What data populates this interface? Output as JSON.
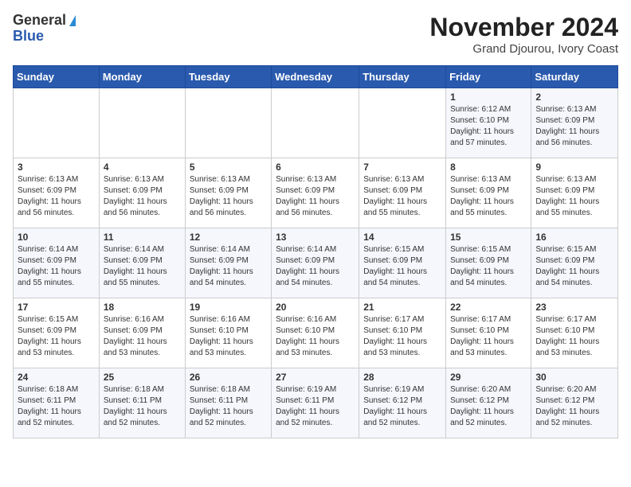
{
  "logo": {
    "general": "General",
    "blue": "Blue"
  },
  "header": {
    "month": "November 2024",
    "location": "Grand Djourou, Ivory Coast"
  },
  "weekdays": [
    "Sunday",
    "Monday",
    "Tuesday",
    "Wednesday",
    "Thursday",
    "Friday",
    "Saturday"
  ],
  "weeks": [
    [
      {
        "day": "",
        "sunrise": "",
        "sunset": "",
        "daylight": ""
      },
      {
        "day": "",
        "sunrise": "",
        "sunset": "",
        "daylight": ""
      },
      {
        "day": "",
        "sunrise": "",
        "sunset": "",
        "daylight": ""
      },
      {
        "day": "",
        "sunrise": "",
        "sunset": "",
        "daylight": ""
      },
      {
        "day": "",
        "sunrise": "",
        "sunset": "",
        "daylight": ""
      },
      {
        "day": "1",
        "sunrise": "Sunrise: 6:12 AM",
        "sunset": "Sunset: 6:10 PM",
        "daylight": "Daylight: 11 hours and 57 minutes."
      },
      {
        "day": "2",
        "sunrise": "Sunrise: 6:13 AM",
        "sunset": "Sunset: 6:09 PM",
        "daylight": "Daylight: 11 hours and 56 minutes."
      }
    ],
    [
      {
        "day": "3",
        "sunrise": "Sunrise: 6:13 AM",
        "sunset": "Sunset: 6:09 PM",
        "daylight": "Daylight: 11 hours and 56 minutes."
      },
      {
        "day": "4",
        "sunrise": "Sunrise: 6:13 AM",
        "sunset": "Sunset: 6:09 PM",
        "daylight": "Daylight: 11 hours and 56 minutes."
      },
      {
        "day": "5",
        "sunrise": "Sunrise: 6:13 AM",
        "sunset": "Sunset: 6:09 PM",
        "daylight": "Daylight: 11 hours and 56 minutes."
      },
      {
        "day": "6",
        "sunrise": "Sunrise: 6:13 AM",
        "sunset": "Sunset: 6:09 PM",
        "daylight": "Daylight: 11 hours and 56 minutes."
      },
      {
        "day": "7",
        "sunrise": "Sunrise: 6:13 AM",
        "sunset": "Sunset: 6:09 PM",
        "daylight": "Daylight: 11 hours and 55 minutes."
      },
      {
        "day": "8",
        "sunrise": "Sunrise: 6:13 AM",
        "sunset": "Sunset: 6:09 PM",
        "daylight": "Daylight: 11 hours and 55 minutes."
      },
      {
        "day": "9",
        "sunrise": "Sunrise: 6:13 AM",
        "sunset": "Sunset: 6:09 PM",
        "daylight": "Daylight: 11 hours and 55 minutes."
      }
    ],
    [
      {
        "day": "10",
        "sunrise": "Sunrise: 6:14 AM",
        "sunset": "Sunset: 6:09 PM",
        "daylight": "Daylight: 11 hours and 55 minutes."
      },
      {
        "day": "11",
        "sunrise": "Sunrise: 6:14 AM",
        "sunset": "Sunset: 6:09 PM",
        "daylight": "Daylight: 11 hours and 55 minutes."
      },
      {
        "day": "12",
        "sunrise": "Sunrise: 6:14 AM",
        "sunset": "Sunset: 6:09 PM",
        "daylight": "Daylight: 11 hours and 54 minutes."
      },
      {
        "day": "13",
        "sunrise": "Sunrise: 6:14 AM",
        "sunset": "Sunset: 6:09 PM",
        "daylight": "Daylight: 11 hours and 54 minutes."
      },
      {
        "day": "14",
        "sunrise": "Sunrise: 6:15 AM",
        "sunset": "Sunset: 6:09 PM",
        "daylight": "Daylight: 11 hours and 54 minutes."
      },
      {
        "day": "15",
        "sunrise": "Sunrise: 6:15 AM",
        "sunset": "Sunset: 6:09 PM",
        "daylight": "Daylight: 11 hours and 54 minutes."
      },
      {
        "day": "16",
        "sunrise": "Sunrise: 6:15 AM",
        "sunset": "Sunset: 6:09 PM",
        "daylight": "Daylight: 11 hours and 54 minutes."
      }
    ],
    [
      {
        "day": "17",
        "sunrise": "Sunrise: 6:15 AM",
        "sunset": "Sunset: 6:09 PM",
        "daylight": "Daylight: 11 hours and 53 minutes."
      },
      {
        "day": "18",
        "sunrise": "Sunrise: 6:16 AM",
        "sunset": "Sunset: 6:09 PM",
        "daylight": "Daylight: 11 hours and 53 minutes."
      },
      {
        "day": "19",
        "sunrise": "Sunrise: 6:16 AM",
        "sunset": "Sunset: 6:10 PM",
        "daylight": "Daylight: 11 hours and 53 minutes."
      },
      {
        "day": "20",
        "sunrise": "Sunrise: 6:16 AM",
        "sunset": "Sunset: 6:10 PM",
        "daylight": "Daylight: 11 hours and 53 minutes."
      },
      {
        "day": "21",
        "sunrise": "Sunrise: 6:17 AM",
        "sunset": "Sunset: 6:10 PM",
        "daylight": "Daylight: 11 hours and 53 minutes."
      },
      {
        "day": "22",
        "sunrise": "Sunrise: 6:17 AM",
        "sunset": "Sunset: 6:10 PM",
        "daylight": "Daylight: 11 hours and 53 minutes."
      },
      {
        "day": "23",
        "sunrise": "Sunrise: 6:17 AM",
        "sunset": "Sunset: 6:10 PM",
        "daylight": "Daylight: 11 hours and 53 minutes."
      }
    ],
    [
      {
        "day": "24",
        "sunrise": "Sunrise: 6:18 AM",
        "sunset": "Sunset: 6:11 PM",
        "daylight": "Daylight: 11 hours and 52 minutes."
      },
      {
        "day": "25",
        "sunrise": "Sunrise: 6:18 AM",
        "sunset": "Sunset: 6:11 PM",
        "daylight": "Daylight: 11 hours and 52 minutes."
      },
      {
        "day": "26",
        "sunrise": "Sunrise: 6:18 AM",
        "sunset": "Sunset: 6:11 PM",
        "daylight": "Daylight: 11 hours and 52 minutes."
      },
      {
        "day": "27",
        "sunrise": "Sunrise: 6:19 AM",
        "sunset": "Sunset: 6:11 PM",
        "daylight": "Daylight: 11 hours and 52 minutes."
      },
      {
        "day": "28",
        "sunrise": "Sunrise: 6:19 AM",
        "sunset": "Sunset: 6:12 PM",
        "daylight": "Daylight: 11 hours and 52 minutes."
      },
      {
        "day": "29",
        "sunrise": "Sunrise: 6:20 AM",
        "sunset": "Sunset: 6:12 PM",
        "daylight": "Daylight: 11 hours and 52 minutes."
      },
      {
        "day": "30",
        "sunrise": "Sunrise: 6:20 AM",
        "sunset": "Sunset: 6:12 PM",
        "daylight": "Daylight: 11 hours and 52 minutes."
      }
    ]
  ]
}
